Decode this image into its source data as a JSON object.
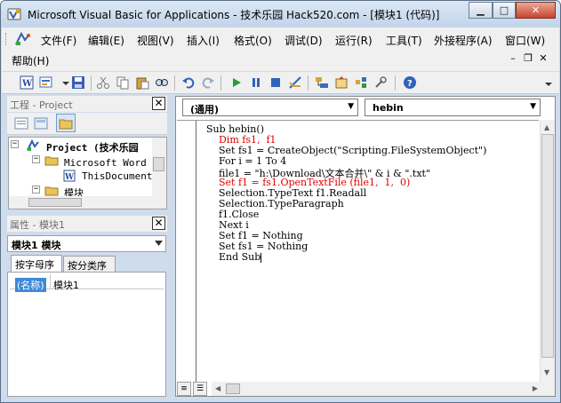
{
  "window": {
    "title": "Microsoft Visual Basic for Applications - 技术乐园 Hack520.com - [模块1 (代码)]",
    "minimize": "▁",
    "maximize": "□",
    "close": "✕"
  },
  "menu": {
    "items": [
      "文件(F)",
      "编辑(E)",
      "视图(V)",
      "插入(I)",
      "格式(O)",
      "调试(D)",
      "运行(R)",
      "工具(T)",
      "外接程序(A)",
      "窗口(W)"
    ],
    "help": "帮助(H)",
    "mdi_min": "–",
    "mdi_restore": "❐",
    "mdi_close": "✕"
  },
  "toolbar": {
    "icons": [
      "word-icon",
      "insert-object-icon",
      "save-icon",
      "cut-icon",
      "copy-icon",
      "paste-icon",
      "find-icon",
      "undo-icon",
      "redo-icon",
      "run-icon",
      "pause-icon",
      "stop-icon",
      "design-mode-icon",
      "project-explorer-icon",
      "properties-icon",
      "object-browser-icon",
      "toolbox-icon",
      "help-icon"
    ]
  },
  "project_panel": {
    "title": "工程 - Project",
    "close": "✕",
    "tree": [
      {
        "label": "Project (技术乐园",
        "level": 0
      },
      {
        "label": "Microsoft Word 对",
        "level": 1
      },
      {
        "label": "ThisDocument",
        "level": 2
      },
      {
        "label": "模块",
        "level": 1
      }
    ]
  },
  "properties_panel": {
    "title": "属性 - 模块1",
    "close": "✕",
    "combo_value": "模块1 模块",
    "tabs": [
      "按字母序",
      "按分类序"
    ],
    "rows": [
      {
        "key": "(名称)",
        "value": "模块1"
      }
    ]
  },
  "code_window": {
    "object_combo": "(通用)",
    "proc_combo": "hebin",
    "lines": [
      {
        "text": "Sub hebin()",
        "err": false
      },
      {
        "text": "    Dim fs1,  f1",
        "err": true
      },
      {
        "text": "    Set fs1 = CreateObject(\"Scripting.FileSystemObject\")",
        "err": false
      },
      {
        "text": "    For i = 1 To 4",
        "err": false
      },
      {
        "text": "    file1 = \"h:\\Download\\文本合并\\\" & i & \".txt\"",
        "err": false
      },
      {
        "text": "    Set f1 = fs1.OpenTextFile (file1,  1,  0)",
        "err": true
      },
      {
        "text": "    Selection.TypeText f1.Readall",
        "err": false
      },
      {
        "text": "    Selection.TypeParagraph",
        "err": false
      },
      {
        "text": "    f1.Close",
        "err": false
      },
      {
        "text": "    Next i",
        "err": false
      },
      {
        "text": "    Set f1 = Nothing",
        "err": false
      },
      {
        "text": "    Set fs1 = Nothing",
        "err": false
      },
      {
        "text": "    End Sub",
        "err": false
      }
    ]
  },
  "colors": {
    "title_bg": "#c8d8ec",
    "menu_bg": "#f0f0f0",
    "code_error": "#e00000",
    "selection": "#3e89d8"
  }
}
